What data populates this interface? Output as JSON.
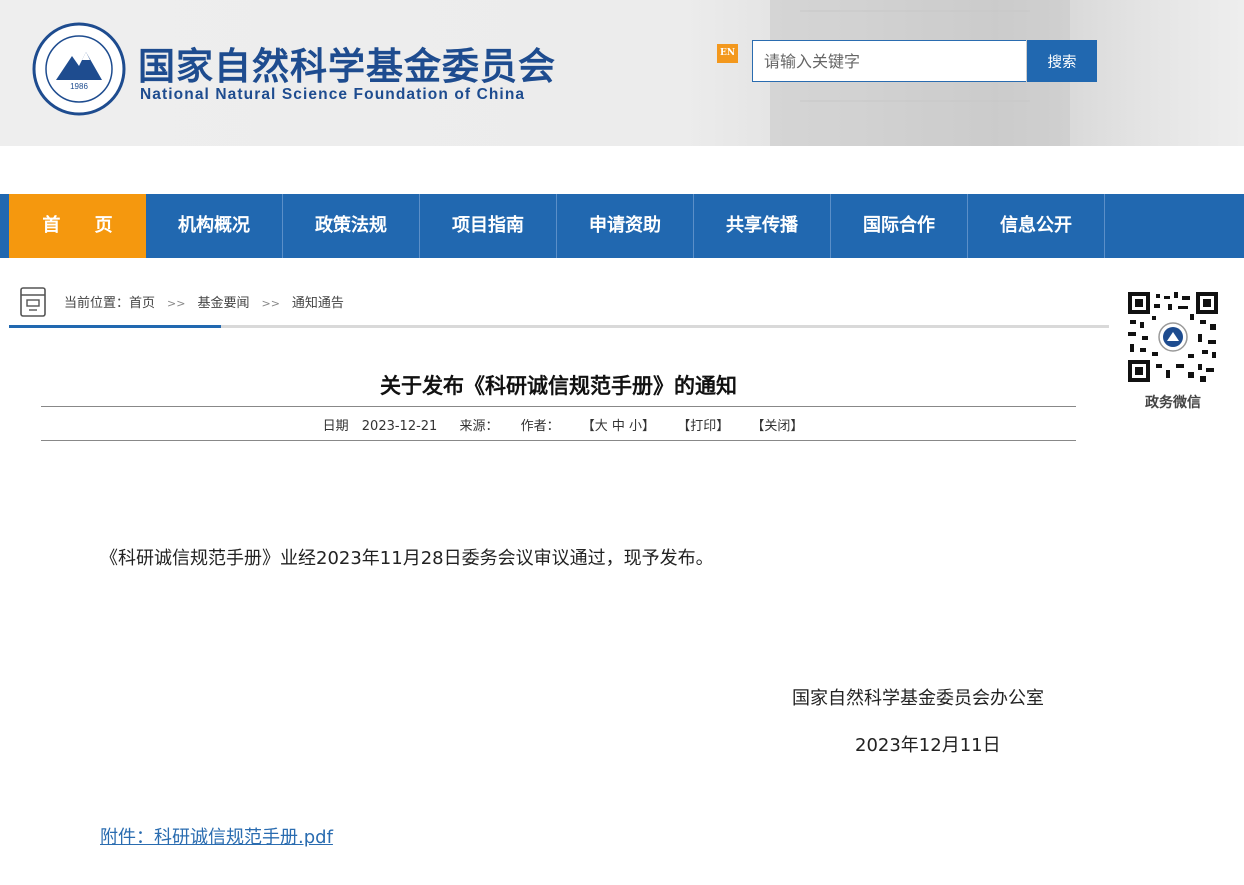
{
  "header": {
    "org_name_cn": "国家自然科学基金委员会",
    "org_name_en": "National Natural Science Foundation of China",
    "logo_year": "1986",
    "lang_switch": "EN",
    "search": {
      "placeholder": "请输入关键字",
      "button_label": "搜索"
    }
  },
  "nav": {
    "items": [
      {
        "label": "首 页",
        "active": true
      },
      {
        "label": "机构概况"
      },
      {
        "label": "政策法规"
      },
      {
        "label": "项目指南"
      },
      {
        "label": "申请资助"
      },
      {
        "label": "共享传播"
      },
      {
        "label": "国际合作"
      },
      {
        "label": "信息公开"
      }
    ]
  },
  "breadcrumb": {
    "prefix": "当前位置：",
    "items": [
      "首页",
      "基金要闻",
      "通知通告"
    ],
    "separator": ">>"
  },
  "sidebar": {
    "qr_label": "政务微信"
  },
  "article": {
    "title": "关于发布《科研诚信规范手册》的通知",
    "date_label": "日期",
    "date": "2023-12-21",
    "source_label": "来源：",
    "author_label": "作者：",
    "font_size_control": "【大 中 小】",
    "print_label": "【打印】",
    "close_label": "【关闭】",
    "body": "《科研诚信规范手册》业经2023年11月28日委务会议审议通过，现予发布。",
    "signature_org": "国家自然科学基金委员会办公室",
    "signature_date": "2023年12月11日",
    "attachment": "附件：科研诚信规范手册.pdf"
  },
  "colors": {
    "primary_blue": "#2168b0",
    "active_orange": "#f5980e",
    "logo_blue": "#1e4c8f",
    "link_blue": "#2a6cb0"
  }
}
